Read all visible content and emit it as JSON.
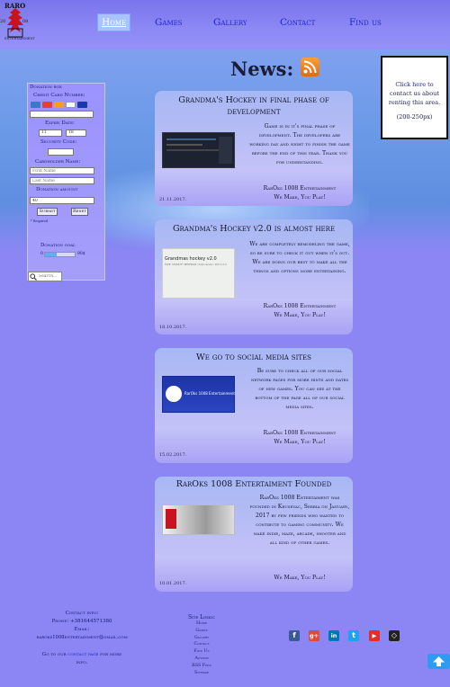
{
  "logo": {
    "title": "RARO",
    "year_left": "20",
    "year_right": "08",
    "bottom": "ENTERTAINMENT"
  },
  "nav": [
    "Home",
    "Games",
    "Gallery",
    "Contact",
    "Find us"
  ],
  "news": {
    "heading": "News:"
  },
  "ad": {
    "link": "Click here",
    "text_lines": [
      "to",
      "contact us about",
      "renting this area."
    ],
    "size": "(200-250px)"
  },
  "donation": {
    "title": "Donation box",
    "card_number_label": "Credit Card Number:",
    "expiry_label": "Expiry Date:",
    "expiry_month": "11",
    "expiry_year": "18",
    "security_label": "Security Code:",
    "holder_label": "Cardholder Name:",
    "first_name_placeholder": "First Name",
    "last_name_placeholder": "Last Name",
    "amount_label": "Donation amount",
    "amount_value": "40",
    "submit": "Submit",
    "reset": "Reset",
    "required": "* Required",
    "goal_label": "Donation goal",
    "goal_start": "0",
    "goal_end": "90$",
    "goal_progress": 0.38,
    "search_placeholder": "Search..."
  },
  "posts": [
    {
      "title": "Grandma's Hockey in final phase of development",
      "body": "Game is in it's final phase of development. The developers are working day and night to finish the game before the end of this year. Thank you for understanding.",
      "sign1": "RarOks 1008 Entertainment",
      "sign2": "We Make, You Play!",
      "date": "21.11.2017."
    },
    {
      "title": "Grandma's Hockey v2.0 is almost here",
      "thumb_title": "Grandmas hockey v2.0",
      "thumb_sub": "FAZE: STABILITY REDESIGN / beta version: 2017.11.0",
      "body": "We are completely remodeling the game, so be sure to check it out when it's out. We are doing our best to make all the things and options more entertaining.",
      "sign1": "RarOks 1008 Entertainment",
      "sign2": "We Make, You Play!",
      "date": "18.10.2017."
    },
    {
      "title": "We go to social media sites",
      "thumb_text": "RarOks 1008 Entertainment",
      "body": "Be sure to check all of our social network pages for more hints and dates of new games. You can see at the bottom of the page all of our social media sites.",
      "sign1": "RarOks 1008 Entertainment",
      "sign2": "We Make, You Play!",
      "date": "15.02.2017."
    },
    {
      "title": "RarOks 1008 Entertaiment Founded",
      "body": "RarOks 1008 Entertaiment was founded in Krusevac, Serbia on January, 2017 by few friends who wanted to contibute to gaming community. We make indie, maze, arcade, shooter and all kind of other games.",
      "sign2": "We Make, You Play!",
      "date": "10.01.2017."
    }
  ],
  "footer": {
    "contact_heading": "Contact info:",
    "phone": "Phone: +381644571380",
    "email_label": "Email:",
    "email": "raroks1008entertainment@gmail.com",
    "go_text_a": "Go to our",
    "go_link": "contact page",
    "go_text_b": "for more",
    "go_text_c": "info.",
    "links_heading": "Site Links:",
    "links": [
      "Home",
      "Games",
      "Gallery",
      "Contact",
      "Find Us",
      "Author",
      "RSS Feed",
      "Sitemap"
    ]
  },
  "social": [
    {
      "icon": "facebook-icon",
      "glyph": "f",
      "color": "#3b5998"
    },
    {
      "icon": "google-plus-icon",
      "glyph": "g+",
      "color": "#dd4b39"
    },
    {
      "icon": "linkedin-icon",
      "glyph": "in",
      "color": "#0077b5"
    },
    {
      "icon": "twitter-icon",
      "glyph": "t",
      "color": "#1da1f2"
    },
    {
      "icon": "youtube-icon",
      "glyph": "▶",
      "color": "#e52d27"
    },
    {
      "icon": "unity-icon",
      "glyph": "◇",
      "color": "#222222"
    }
  ]
}
